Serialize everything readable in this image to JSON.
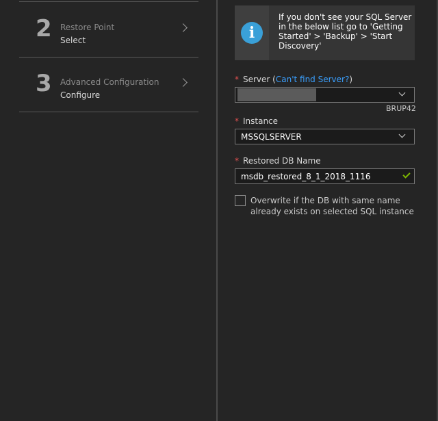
{
  "steps": [
    {
      "number": "2",
      "title": "Restore Point",
      "subtitle": "Select"
    },
    {
      "number": "3",
      "title": "Advanced Configuration",
      "subtitle": "Configure"
    }
  ],
  "info": {
    "text": "If you don't see your SQL Server in the below list go to 'Getting Started' > 'Backup' > 'Start Discovery'",
    "icon": "info-icon"
  },
  "server": {
    "label": "Server",
    "link_open": " (",
    "link_text": "Can't find Server?",
    "link_close": ")",
    "required_mark": "*",
    "note": "BRUP42"
  },
  "instance": {
    "label": "Instance",
    "required_mark": "*",
    "value": "MSSQLSERVER"
  },
  "restored_db": {
    "label": "Restored DB Name",
    "required_mark": "*",
    "value": "msdb_restored_8_1_2018_1116"
  },
  "overwrite": {
    "label": "Overwrite if the DB with same name already exists on selected SQL instance",
    "checked": false
  },
  "colors": {
    "accent": "#3aa0d8",
    "link": "#3aa0ff",
    "required": "#e05050",
    "valid": "#7fba00"
  }
}
